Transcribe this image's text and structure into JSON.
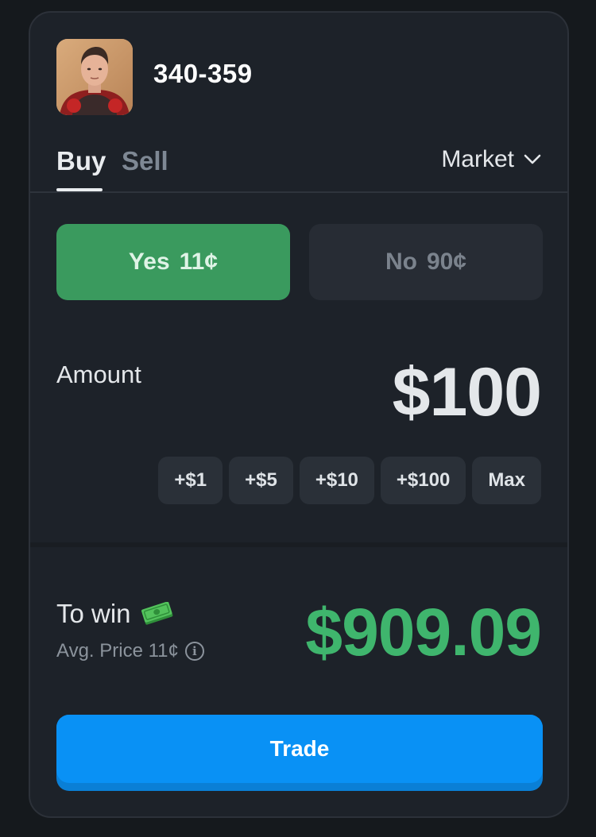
{
  "market": {
    "title": "340-359",
    "avatar_alt": "profile photo"
  },
  "tabs": {
    "buy": "Buy",
    "sell": "Sell",
    "active": "Buy"
  },
  "order_type": {
    "selected": "Market"
  },
  "outcomes": {
    "yes": {
      "label": "Yes",
      "price": "11¢"
    },
    "no": {
      "label": "No",
      "price": "90¢"
    },
    "selected": "Yes"
  },
  "amount": {
    "label": "Amount",
    "value": "$100",
    "quick_add": [
      "+$1",
      "+$5",
      "+$10",
      "+$100",
      "Max"
    ]
  },
  "payout": {
    "label": "To win",
    "icon": "money-icon",
    "avg_price_label": "Avg. Price 11¢",
    "value": "$909.09"
  },
  "trade_button": {
    "label": "Trade"
  },
  "colors": {
    "yes_active": "#3a9a5e",
    "win_green": "#3fb56d",
    "trade_blue": "#0991f5",
    "card_bg": "#1d2229"
  }
}
